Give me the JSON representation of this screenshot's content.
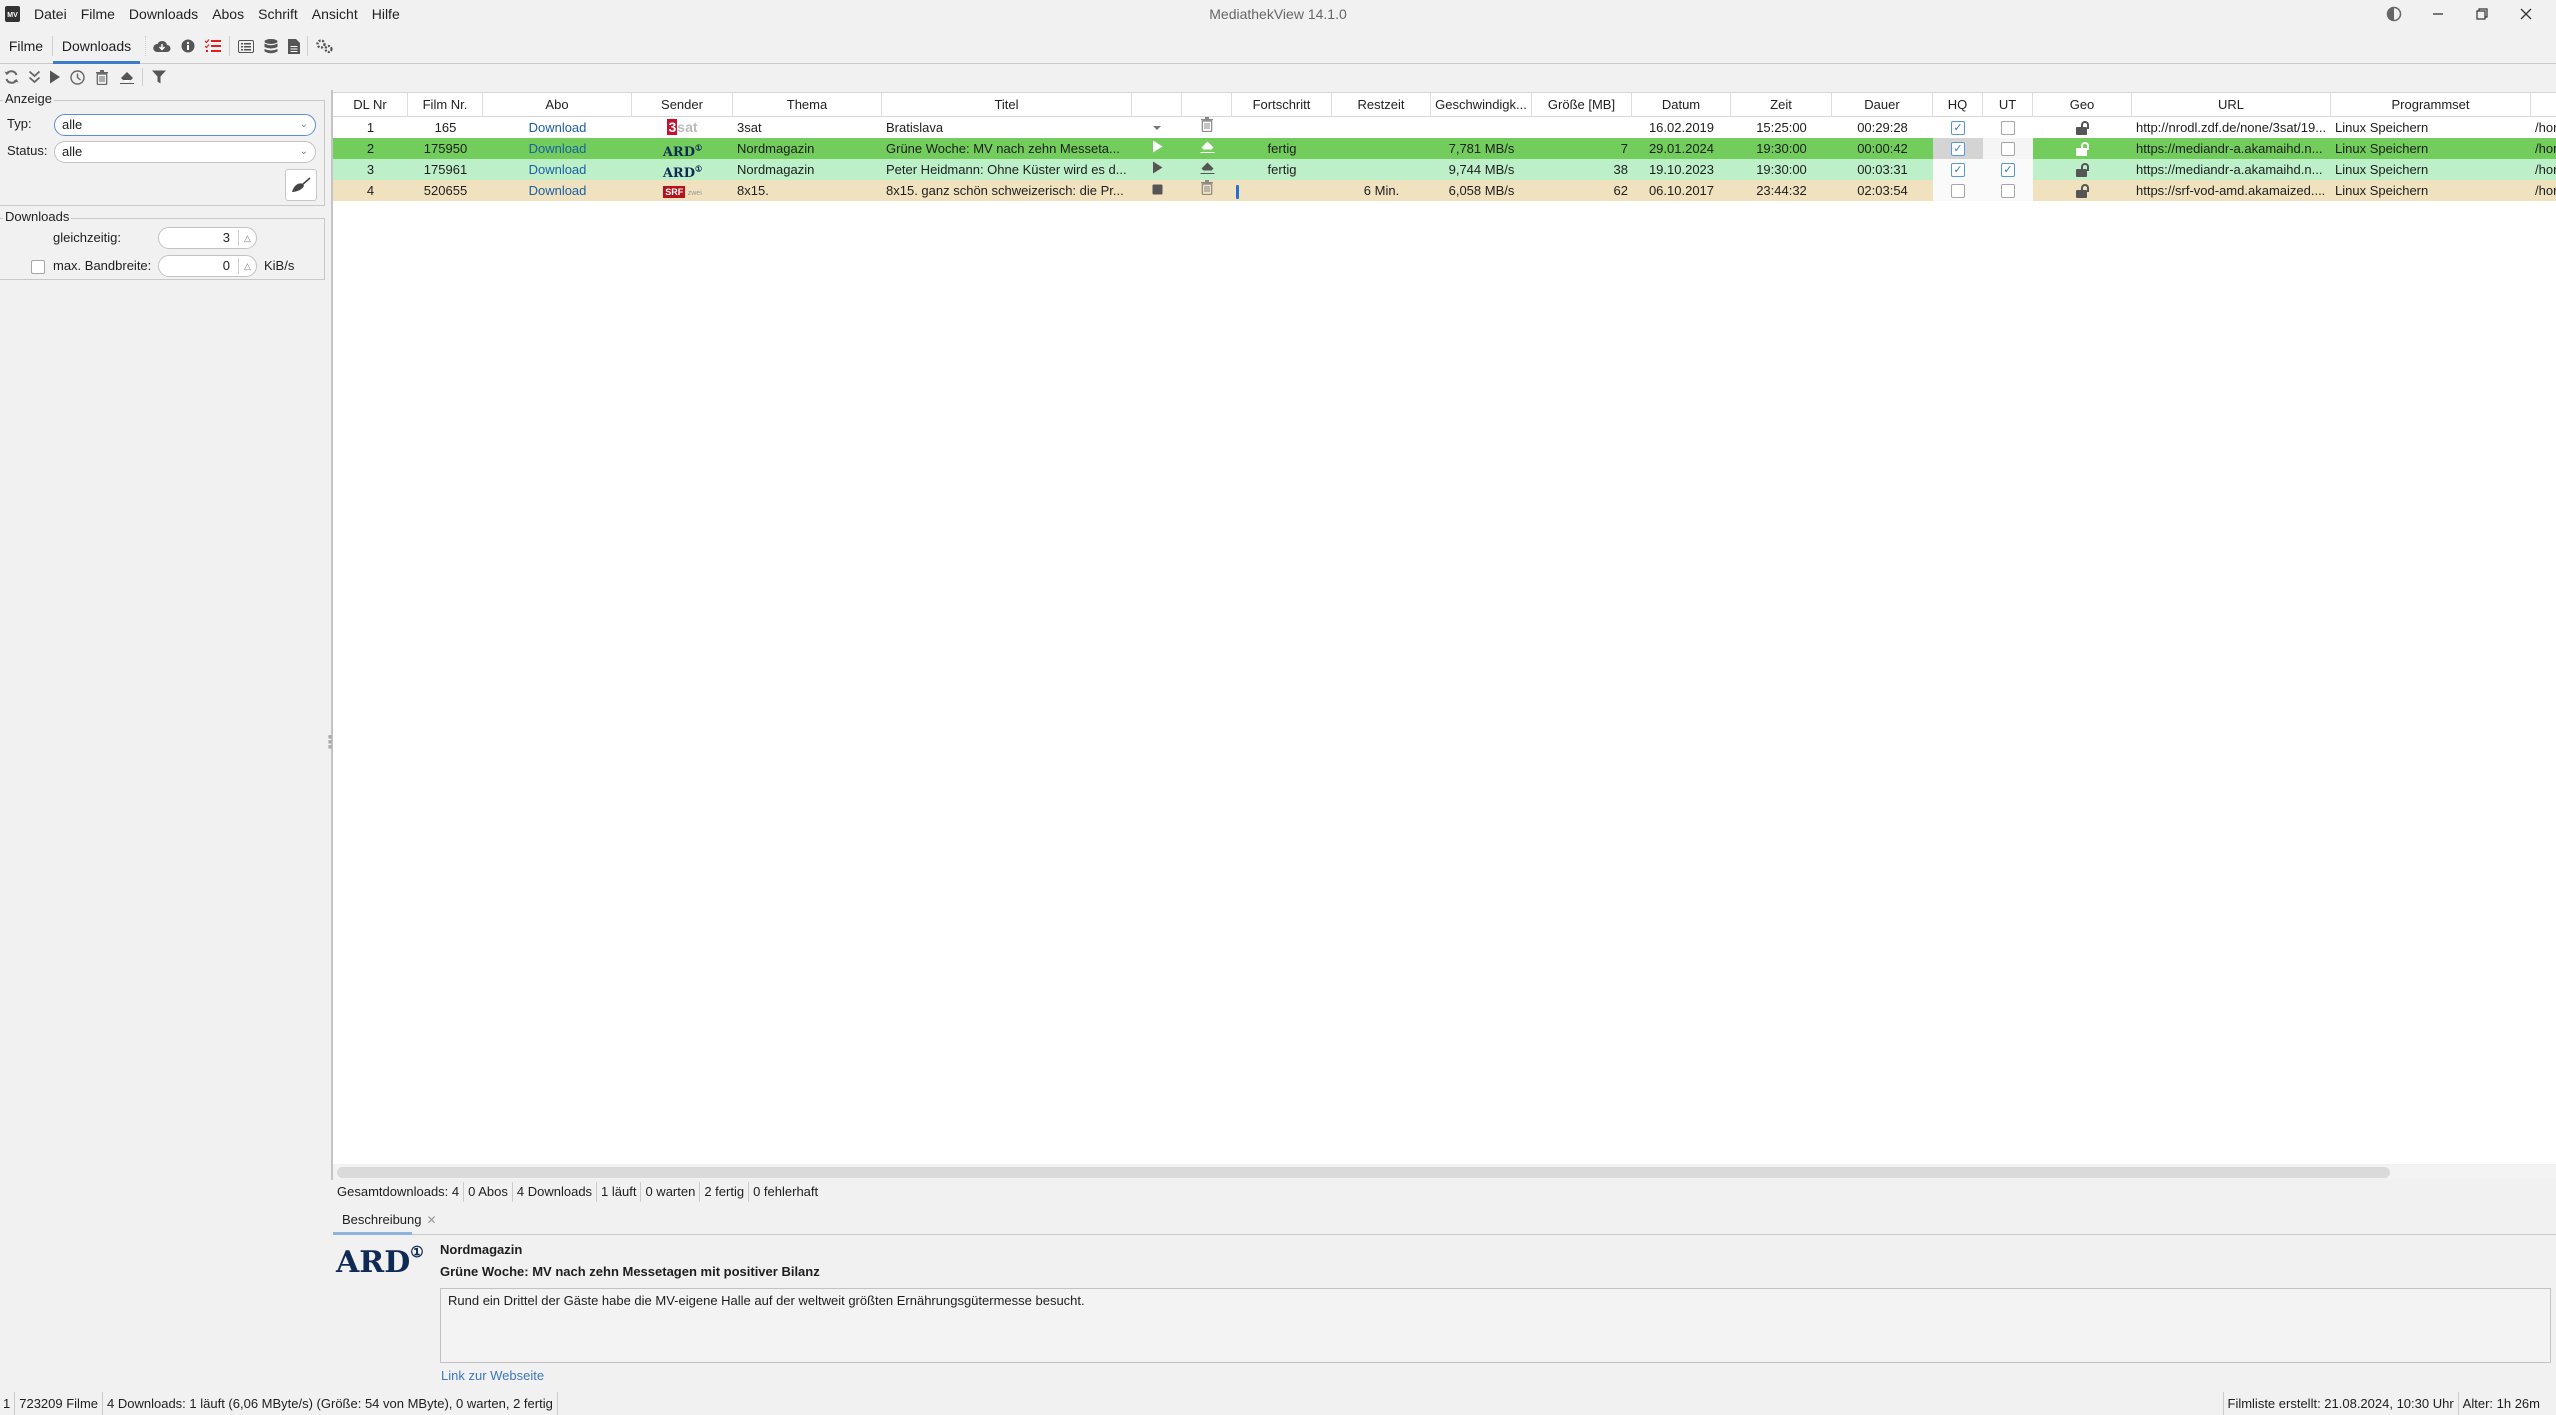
{
  "window": {
    "title": "MediathekView 14.1.0",
    "app_icon": "mv-clapperboard-icon",
    "controls": [
      "theme-toggle-icon",
      "minimize-icon",
      "restore-icon",
      "close-icon"
    ]
  },
  "menu": [
    "Datei",
    "Filme",
    "Downloads",
    "Abos",
    "Schrift",
    "Ansicht",
    "Hilfe"
  ],
  "tabs": [
    {
      "label": "Filme",
      "active": false
    },
    {
      "label": "Downloads",
      "active": true
    }
  ],
  "toolbar_icons": [
    "cloud-download-icon",
    "info-icon",
    "checklist-icon",
    "list-view-icon",
    "database-icon",
    "document-icon",
    "settings-gears-icon"
  ],
  "toolbar2_icons": [
    "refresh-icon",
    "download-all-icon",
    "play-icon",
    "clock-icon",
    "trash-icon",
    "eraser-icon",
    "filter-icon"
  ],
  "sidebar": {
    "anzeige": {
      "title": "Anzeige",
      "typ_label": "Typ:",
      "typ_value": "alle",
      "status_label": "Status:",
      "status_value": "alle",
      "clear_button_icon": "broom-icon"
    },
    "downloads": {
      "title": "Downloads",
      "gleichzeitig_label": "gleichzeitig:",
      "gleichzeitig_value": "3",
      "bandbreite_label": "max. Bandbreite:",
      "bandbreite_checked": false,
      "bandbreite_value": "0",
      "bandbreite_unit": "KiB/s"
    }
  },
  "table": {
    "columns": [
      "DL Nr",
      "Film Nr.",
      "Abo",
      "Sender",
      "Thema",
      "Titel",
      "",
      "",
      "Fortschritt",
      "Restzeit",
      "Geschwindigk...",
      "Größe [MB]",
      "Datum",
      "Zeit",
      "Dauer",
      "HQ",
      "UT",
      "Geo",
      "URL",
      "Programmset",
      ""
    ],
    "rows": [
      {
        "dl_nr": "1",
        "film_nr": "165",
        "abo": "Download",
        "sender": "3sat",
        "thema": "3sat",
        "titel": "Bratislava",
        "action_icon": "download-arrow-icon",
        "remove_icon": "trash-icon",
        "fortschritt": "",
        "progress": 0,
        "restzeit": "",
        "geschwindigkeit": "",
        "groesse": "",
        "datum": "16.02.2019",
        "zeit": "15:25:00",
        "dauer": "00:29:28",
        "hq": true,
        "ut": false,
        "geo": "unlocked",
        "url": "http://nrodl.zdf.de/none/3sat/19...",
        "programmset": "Linux Speichern",
        "ziel": "/hor",
        "state": "wait"
      },
      {
        "dl_nr": "2",
        "film_nr": "175950",
        "abo": "Download",
        "sender": "ARD",
        "thema": "Nordmagazin",
        "titel": "Grüne Woche: MV nach zehn Messeta...",
        "action_icon": "play-icon",
        "remove_icon": "eraser-icon",
        "fortschritt": "fertig",
        "progress": 100,
        "restzeit": "",
        "geschwindigkeit": "7,781 MB/s",
        "groesse": "7",
        "datum": "29.01.2024",
        "zeit": "19:30:00",
        "dauer": "00:00:42",
        "hq": true,
        "ut": false,
        "geo": "unlocked",
        "url": "https://mediandr-a.akamaihd.n...",
        "programmset": "Linux Speichern",
        "ziel": "/hor",
        "state": "selected"
      },
      {
        "dl_nr": "3",
        "film_nr": "175961",
        "abo": "Download",
        "sender": "ARD",
        "thema": "Nordmagazin",
        "titel": "Peter Heidmann: Ohne Küster wird es d...",
        "action_icon": "play-icon",
        "remove_icon": "eraser-icon",
        "fortschritt": "fertig",
        "progress": 100,
        "restzeit": "",
        "geschwindigkeit": "9,744 MB/s",
        "groesse": "38",
        "datum": "19.10.2023",
        "zeit": "19:30:00",
        "dauer": "00:03:31",
        "hq": true,
        "ut": true,
        "geo": "unlocked",
        "url": "https://mediandr-a.akamaihd.n...",
        "programmset": "Linux Speichern",
        "ziel": "/hor",
        "state": "done"
      },
      {
        "dl_nr": "4",
        "film_nr": "520655",
        "abo": "Download",
        "sender": "SRF",
        "thema": "8x15.",
        "titel": "8x15. ganz schön schweizerisch: die Pr...",
        "action_icon": "stop-icon",
        "remove_icon": "trash-icon",
        "fortschritt": "",
        "progress": 1,
        "restzeit": "6 Min.",
        "geschwindigkeit": "6,058 MB/s",
        "groesse": "62",
        "datum": "06.10.2017",
        "zeit": "23:44:32",
        "dauer": "02:03:54",
        "hq": false,
        "ut": false,
        "geo": "unlocked",
        "url": "https://srf-vod-amd.akamaized....",
        "programmset": "Linux Speichern",
        "ziel": "/hor",
        "state": "running"
      }
    ]
  },
  "summary": [
    "Gesamtdownloads: 4",
    "0 Abos",
    "4 Downloads",
    "1 läuft",
    "0 warten",
    "2 fertig",
    "0 fehlerhaft"
  ],
  "description": {
    "tab_label": "Beschreibung",
    "sender_logo": "ARD",
    "thema": "Nordmagazin",
    "title": "Grüne Woche: MV nach zehn Messetagen mit positiver Bilanz",
    "text": "Rund ein Drittel der Gäste habe die MV-eigene Halle auf der weltweit größten Ernährungsgütermesse besucht.",
    "link_label": "Link zur Webseite"
  },
  "statusbar": {
    "left": [
      "1",
      "723209 Filme",
      "4 Downloads: 1 läuft (6,06 MByte/s) (Größe: 54 von  MByte), 0 warten, 2 fertig"
    ],
    "right": [
      "Filmliste erstellt: 21.08.2024, 10:30 Uhr",
      "Alter: 1h 26m"
    ]
  },
  "colors": {
    "row_selected": "#72cd5c",
    "row_done": "#bdf0c9",
    "row_running": "#f1e2bf",
    "accent": "#3d7cc9",
    "link": "#1b5fa5"
  }
}
